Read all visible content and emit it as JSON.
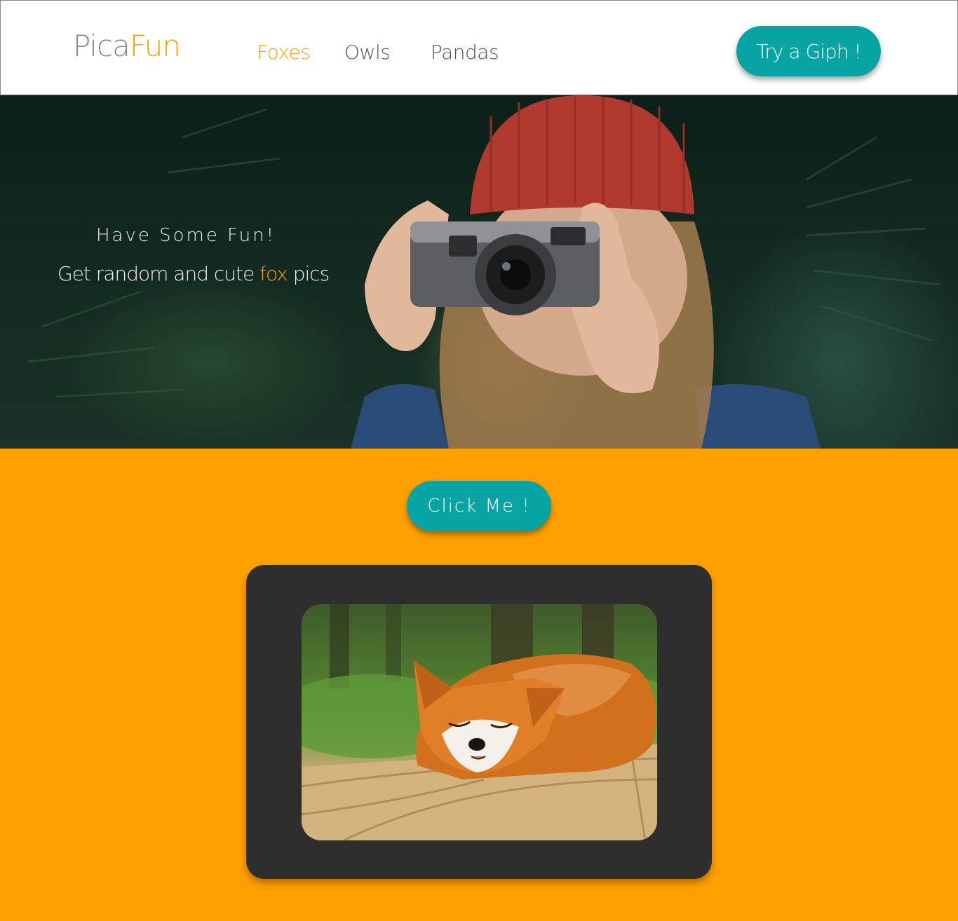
{
  "header": {
    "brand_part1": "Pica",
    "brand_part2": "Fun",
    "nav": [
      {
        "label": "Foxes",
        "active": true
      },
      {
        "label": "Owls",
        "active": false
      },
      {
        "label": "Pandas",
        "active": false
      }
    ],
    "cta_label": "Try a Giph !"
  },
  "hero": {
    "tagline": "Have Some Fun!",
    "subtitle_before": "Get random and cute ",
    "subtitle_accent": "fox",
    "subtitle_after": " pics",
    "image_icon": "photographer-camera-image"
  },
  "main": {
    "button_label": "Click Me !",
    "image_icon": "sleeping-fox-image"
  },
  "colors": {
    "accent": "#ffa000",
    "button": "#08a4a4",
    "frame": "#2e2e2e",
    "nav_text": "#555555",
    "brand_text": "#8a8a8a"
  }
}
